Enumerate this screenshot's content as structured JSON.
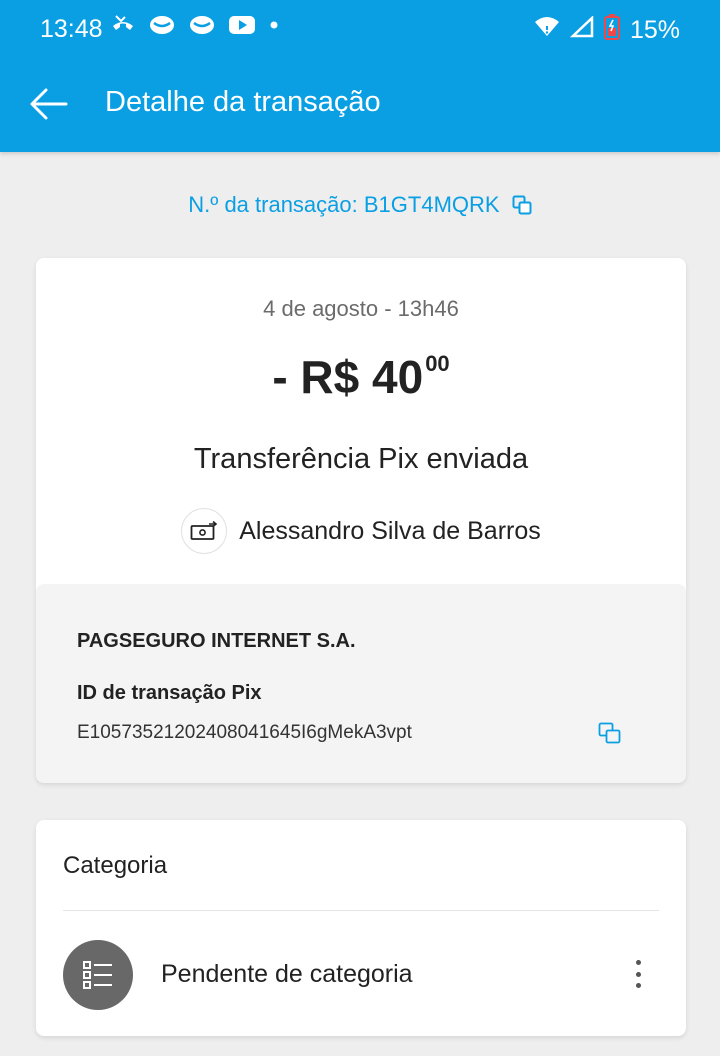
{
  "status_bar": {
    "time": "13:48",
    "battery": "15%",
    "icons_left": [
      "missed-call-icon",
      "chat-bubble-icon",
      "chat-bubble-icon",
      "youtube-icon",
      "dot-icon"
    ],
    "icons_right": [
      "wifi-icon",
      "signal-icon",
      "battery-icon"
    ]
  },
  "toolbar": {
    "title": "Detalhe da transação",
    "back_icon": "arrow-left-icon"
  },
  "transaction": {
    "number_label": "N.º da transação: B1GT4MQRK",
    "date": "4 de agosto - 13h46",
    "amount_main": "- R$ 40",
    "amount_cents": "00",
    "type": "Transferência Pix enviada",
    "recipient": "Alessandro Silva de Barros",
    "institution": "PAGSEGURO INTERNET S.A.",
    "pix_id_label": "ID de transação Pix",
    "pix_id": "E10573521202408041645I6gMekA3vpt"
  },
  "category": {
    "title": "Categoria",
    "value": "Pendente de categoria"
  },
  "colors": {
    "brand_blue": "#0a9fe3",
    "background": "#eeeeee"
  }
}
